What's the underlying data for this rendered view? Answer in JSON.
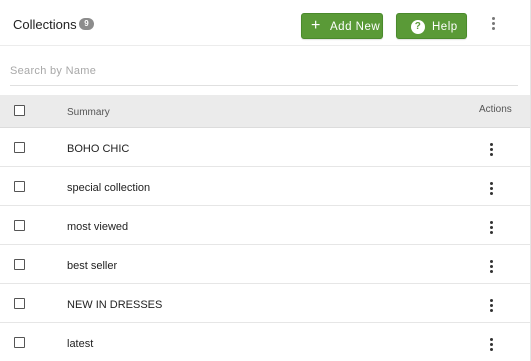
{
  "header": {
    "title": "Collections",
    "count": "9",
    "add_new_label": "Add New",
    "add_icon": "plus-icon",
    "help_label": "Help",
    "help_icon": "question-circle-icon",
    "more_icon": "more-vertical-icon"
  },
  "search": {
    "placeholder": "Search by Name",
    "value": ""
  },
  "table": {
    "columns": [
      "",
      "Summary",
      "Actions"
    ],
    "rows": [
      {
        "name": "BOHO CHIC"
      },
      {
        "name": "special collection"
      },
      {
        "name": "most viewed"
      },
      {
        "name": "best seller"
      },
      {
        "name": "NEW IN DRESSES"
      },
      {
        "name": "latest"
      }
    ]
  },
  "colors": {
    "primary_button": "#5a9a37",
    "badge": "#8c8c8c",
    "table_header_bg": "#ebebeb"
  }
}
